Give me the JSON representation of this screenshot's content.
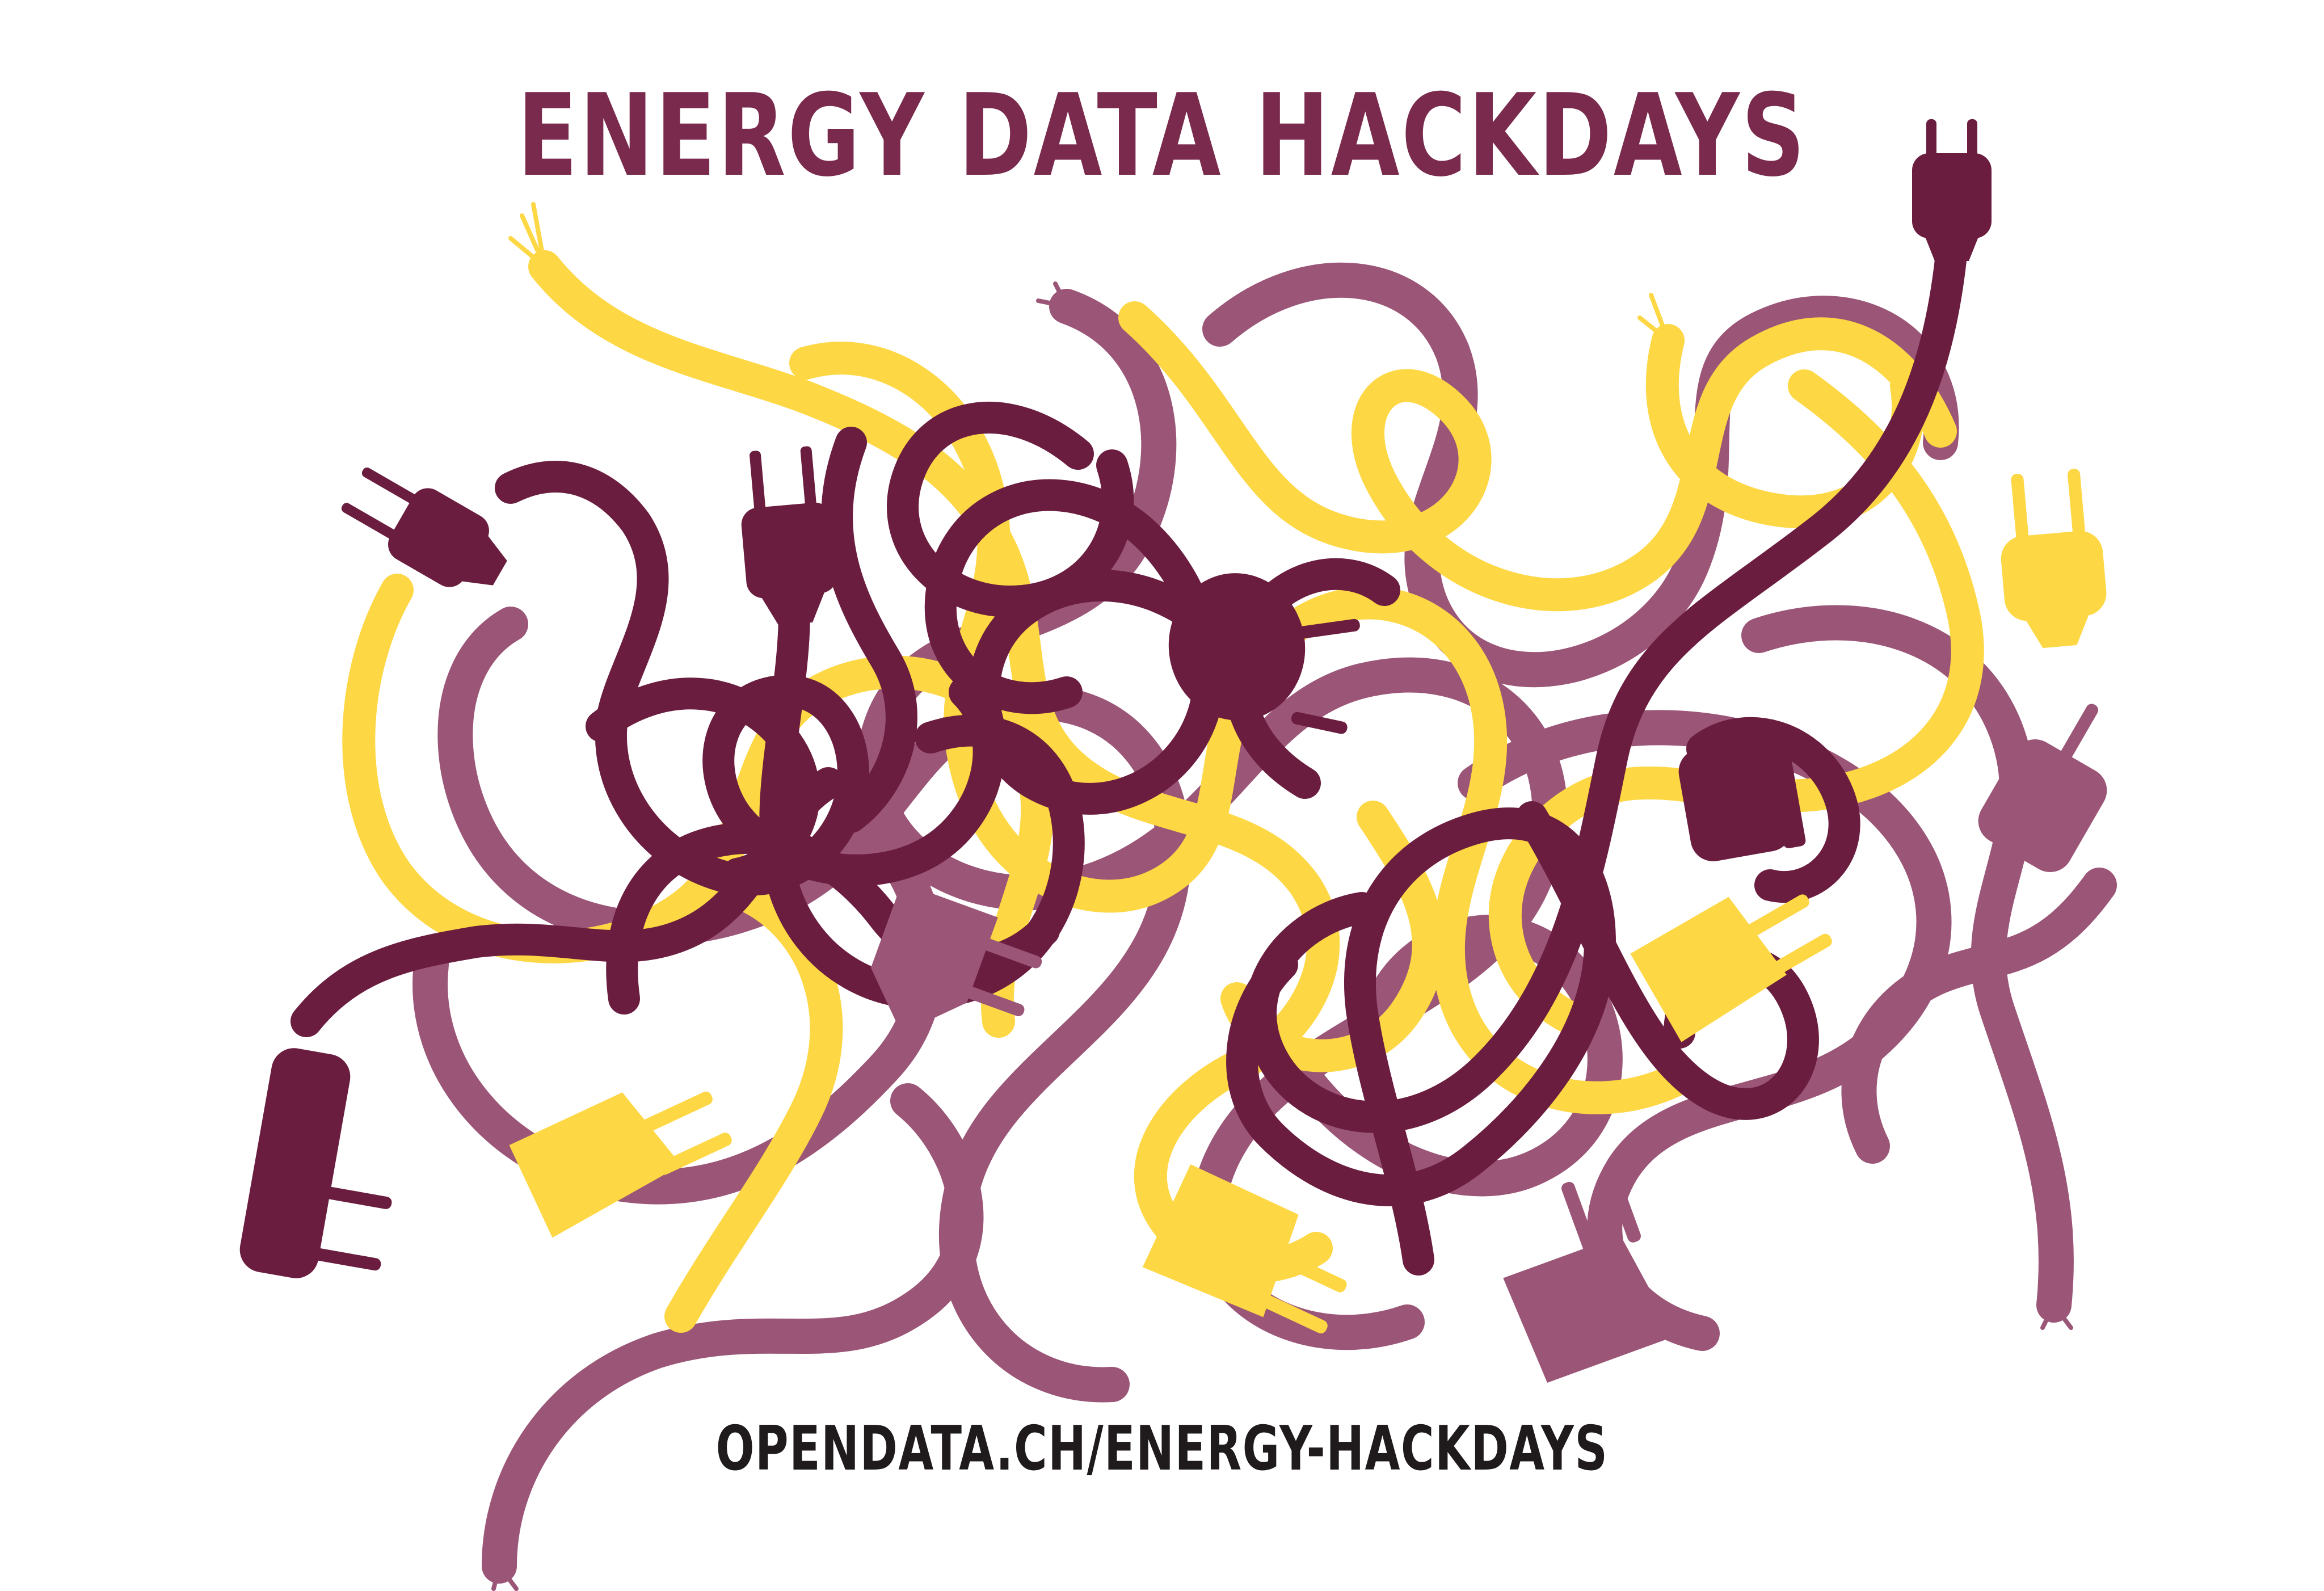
{
  "poster": {
    "title": "ENERGY DATA HACKDAYS",
    "url": "OPENDATA.CH/ENERGY-HACKDAYS"
  },
  "illustration": {
    "subject": "tangled-power-cables-with-plugs",
    "icon": "plug-icon"
  },
  "colors": {
    "background": "#ffffff",
    "title": "#7a2a4c",
    "url": "#1f1a1c",
    "cable_dark": "#6b1d3f",
    "cable_mauve": "#9b5577",
    "cable_yellow": "#fdd744"
  }
}
